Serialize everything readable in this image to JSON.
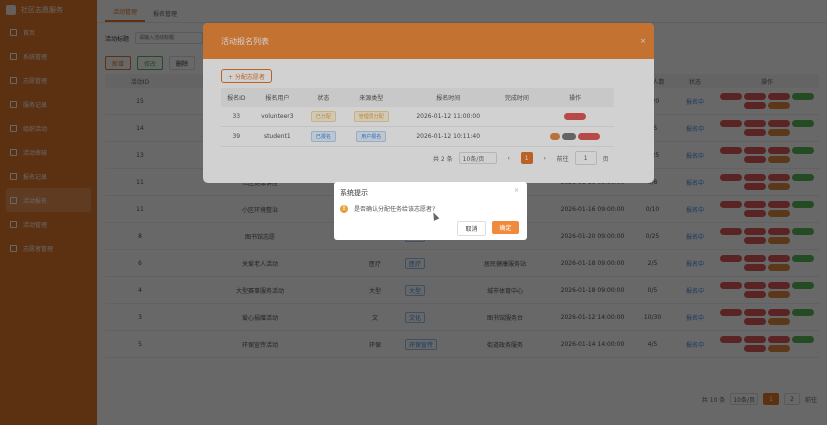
{
  "brand": {
    "title": "社区志愿服务"
  },
  "sidebar": {
    "items": [
      {
        "label": "首页"
      },
      {
        "label": "系统管理"
      },
      {
        "label": "志愿管理"
      },
      {
        "label": "服务记录"
      },
      {
        "label": "组织活动"
      },
      {
        "label": "活动审核"
      },
      {
        "label": "报名记录"
      },
      {
        "label": "活动报名"
      },
      {
        "label": "活动管理"
      },
      {
        "label": "志愿者管理"
      }
    ]
  },
  "tabs": [
    {
      "label": "活动管理"
    },
    {
      "label": "报名管理"
    }
  ],
  "search": {
    "label": "活动标题",
    "placeholder": "请输入活动标题"
  },
  "toolbar": {
    "add": "新增",
    "edit": "修改",
    "delete": "删除"
  },
  "main_table": {
    "headers": {
      "id": "活动ID",
      "name": "",
      "org": "",
      "type": "",
      "loc": "",
      "time": "",
      "count": "报名人数",
      "status": "状态",
      "op": "操作"
    },
    "rows": [
      {
        "id": "15",
        "name": "",
        "org": "",
        "type": "",
        "loc": "",
        "time": "",
        "count": "0/20",
        "status": "报名中"
      },
      {
        "id": "14",
        "name": "",
        "org": "",
        "type": "",
        "loc": "",
        "time": "",
        "count": "1/5",
        "status": "报名中"
      },
      {
        "id": "13",
        "name": "",
        "org": "",
        "type": "",
        "loc": "",
        "time": "",
        "count": "0/25",
        "status": "报名中"
      },
      {
        "id": "11",
        "name": "社区健康讲座",
        "org": "",
        "type": "",
        "loc": "",
        "time": "2026-01-16 09:00:00",
        "count": "0/8",
        "status": "报名中"
      },
      {
        "id": "11",
        "name": "小区环境整治",
        "org": "",
        "type": "",
        "loc": "",
        "time": "2026-01-16 09:00:00",
        "count": "0/10",
        "status": "报名中"
      },
      {
        "id": "8",
        "name": "图书馆志愿",
        "org": "文",
        "type": "教育",
        "loc": "青年活动中心",
        "time": "2026-01-20 09:00:00",
        "count": "0/25",
        "status": "报名中"
      },
      {
        "id": "6",
        "name": "关爱老人活动",
        "org": "医疗",
        "type": "医疗",
        "loc": "居民健康服务站",
        "time": "2026-01-18 09:00:00",
        "count": "2/5",
        "status": "报名中"
      },
      {
        "id": "4",
        "name": "大型赛事服务活动",
        "org": "大型",
        "type": "大型",
        "loc": "城市体育中心",
        "time": "2026-01-18 09:00:00",
        "count": "0/5",
        "status": "报名中"
      },
      {
        "id": "3",
        "name": "爱心捐赠活动",
        "org": "文",
        "type": "文化",
        "loc": "图书馆服务台",
        "time": "2026-01-12 14:00:00",
        "count": "10/30",
        "status": "报名中"
      },
      {
        "id": "5",
        "name": "环保宣传活动",
        "org": "环保",
        "type": "环保宣传",
        "loc": "街道政务服务",
        "time": "2026-01-14 14:00:00",
        "count": "4/5",
        "status": "报名中"
      }
    ]
  },
  "main_pager": {
    "total": "共 10 条",
    "size": "10条/页",
    "current": "1",
    "next": "2",
    "goto": "前往"
  },
  "dialog": {
    "title": "活动报名列表",
    "close": "×",
    "assign_button": "+ 分配志愿者",
    "headers": [
      "报名ID",
      "报名用户",
      "状态",
      "来源类型",
      "报名时间",
      "完成时间",
      "操作"
    ],
    "rows": [
      {
        "id": "33",
        "user": "volunteer3",
        "status": "已分配",
        "source": "管理员分配",
        "time": "2026-01-12 11:00:00",
        "done": ""
      },
      {
        "id": "39",
        "user": "student1",
        "status": "已报名",
        "source": "用户报名",
        "time": "2026-01-12 10:11:40",
        "done": ""
      }
    ],
    "pager": {
      "total": "共 2 条",
      "size": "10条/页",
      "prev": "‹",
      "current": "1",
      "next": "›",
      "goto": "前往",
      "page": "1",
      "unit": "页"
    }
  },
  "confirm": {
    "title": "系统提示",
    "close": "×",
    "icon": "!",
    "message": "是否确认分配任务给该志愿者?",
    "cancel": "取消",
    "ok": "确定"
  },
  "colors": {
    "accent": "#e2782d",
    "dialog_header": "#f08b3d"
  }
}
